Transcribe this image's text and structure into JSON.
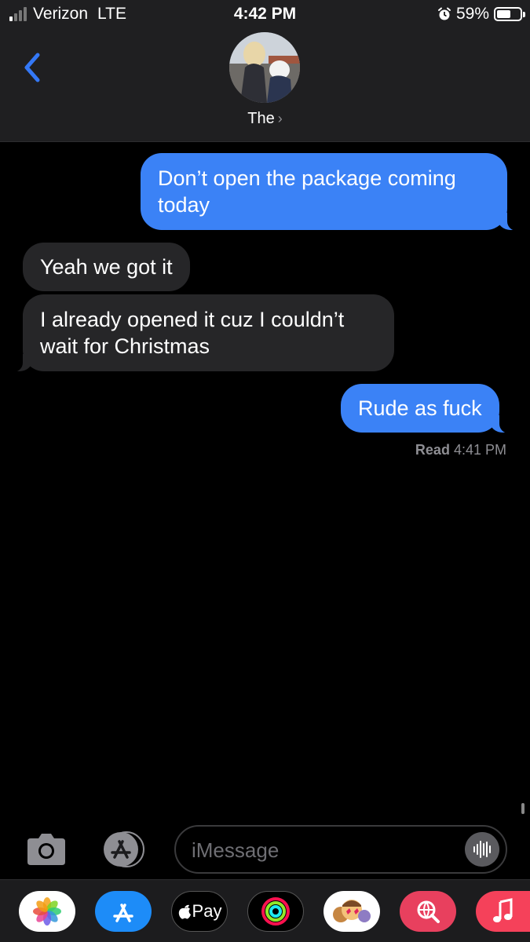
{
  "status_bar": {
    "carrier": "Verizon",
    "network": "LTE",
    "time": "4:42 PM",
    "battery_percent": "59%",
    "battery_level": 0.59,
    "signal_bars_filled": 1,
    "signal_bars_total": 4
  },
  "header": {
    "back_icon": "chevron-left-icon",
    "contact_name": "The",
    "chevron": "›"
  },
  "messages": [
    {
      "direction": "outgoing",
      "text": "Don’t open the package coming today"
    },
    {
      "direction": "incoming",
      "text": "Yeah we got it"
    },
    {
      "direction": "incoming",
      "text": "I already opened it cuz I couldn’t wait for Christmas"
    },
    {
      "direction": "outgoing",
      "text": "Rude as fuck"
    }
  ],
  "receipt": {
    "label": "Read",
    "time": "4:41 PM"
  },
  "composer": {
    "placeholder": "iMessage",
    "camera_icon": "camera-icon",
    "apps_icon": "app-store-icon",
    "audio_icon": "audio-waveform-icon"
  },
  "app_drawer": {
    "apps": [
      {
        "name": "photos-icon"
      },
      {
        "name": "app-store-icon"
      },
      {
        "name": "apple-pay-icon",
        "label": "Pay"
      },
      {
        "name": "activity-icon"
      },
      {
        "name": "memoji-icon"
      },
      {
        "name": "web-search-icon"
      },
      {
        "name": "music-icon"
      }
    ]
  },
  "colors": {
    "outgoing_bubble": "#3b82f6",
    "incoming_bubble": "#262628",
    "accent": "#3478f6",
    "background": "#000000"
  }
}
